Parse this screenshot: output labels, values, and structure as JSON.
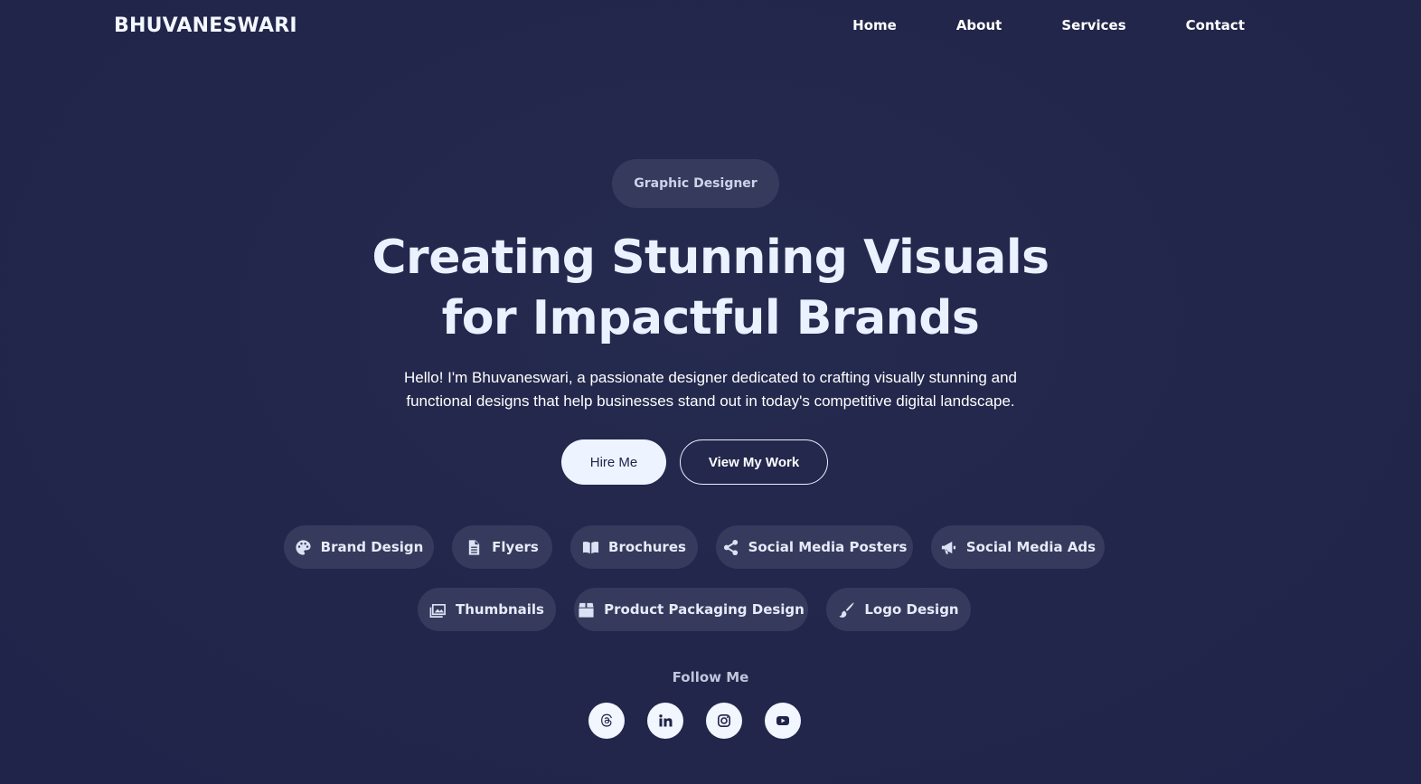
{
  "brand": "BHUVANESWARI",
  "nav": {
    "links": [
      "Home",
      "About",
      "Services",
      "Contact"
    ]
  },
  "hero": {
    "role_badge": "Graphic Designer",
    "headline_line1": "Creating Stunning Visuals",
    "headline_line2": "for Impactful Brands",
    "intro_line1": "Hello! I'm Bhuvaneswari, a passionate designer dedicated to crafting visually stunning and",
    "intro_line2": "functional designs that help businesses stand out in today's competitive digital landscape.",
    "hire_label": "Hire Me",
    "work_label": "View My Work"
  },
  "services": [
    {
      "label": "Brand Design",
      "icon": "palette-icon"
    },
    {
      "label": "Flyers",
      "icon": "document-icon"
    },
    {
      "label": "Brochures",
      "icon": "book-open-icon"
    },
    {
      "label": "Social Media Posters",
      "icon": "share-icon"
    },
    {
      "label": "Social Media Ads",
      "icon": "megaphone-icon"
    },
    {
      "label": "Thumbnails",
      "icon": "images-icon"
    },
    {
      "label": "Product Packaging Design",
      "icon": "box-icon"
    },
    {
      "label": "Logo Design",
      "icon": "paintbrush-icon"
    }
  ],
  "follow": {
    "title": "Follow Me",
    "socials": [
      "threads-icon",
      "linkedin-icon",
      "instagram-icon",
      "youtube-icon"
    ]
  },
  "colors": {
    "background": "#22264a",
    "chip": "#363a5c",
    "text": "#eaf1ff"
  }
}
